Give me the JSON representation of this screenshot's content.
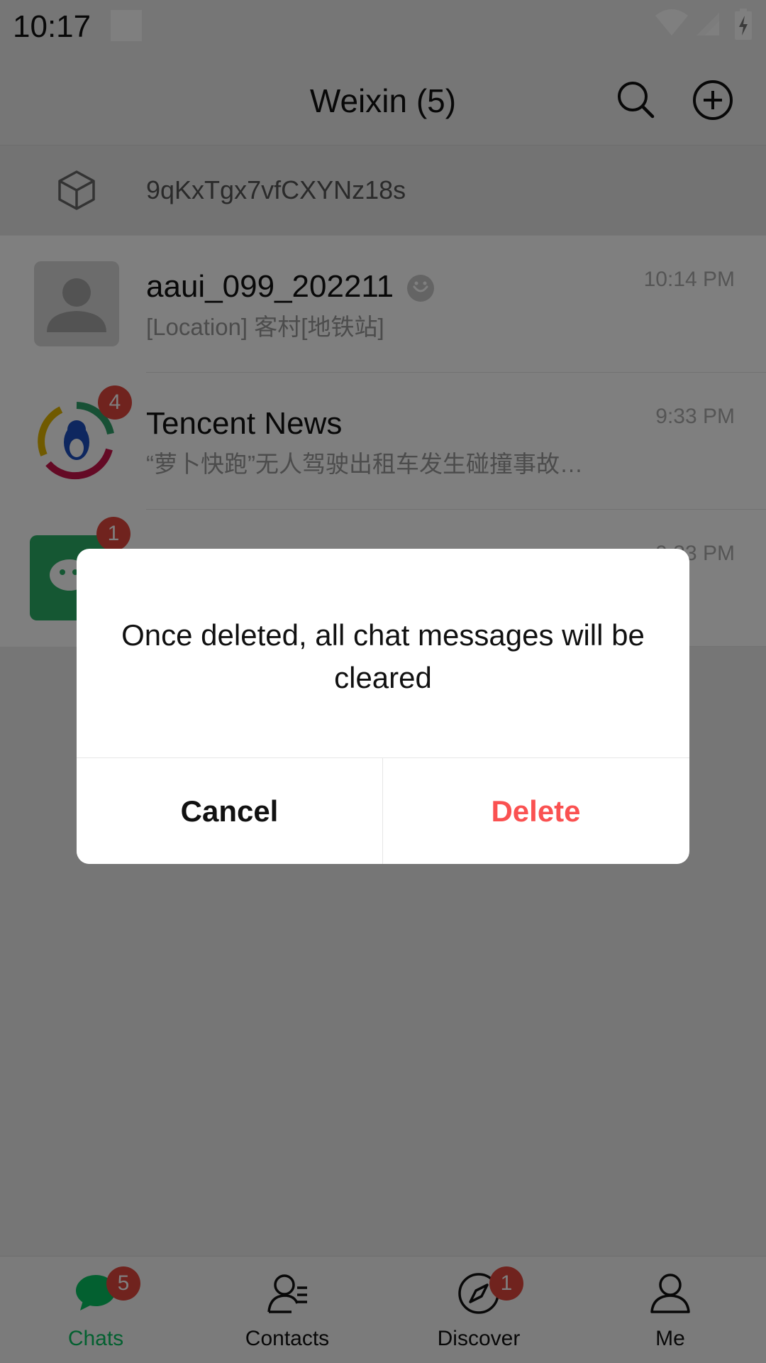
{
  "status_bar": {
    "time": "10:17"
  },
  "header": {
    "title": "Weixin (5)"
  },
  "device_bar": {
    "text": "9qKxTgx7vfCXYNz18s"
  },
  "chats": [
    {
      "name": "aaui_099_202211",
      "preview": "[Location]  客村[地铁站]",
      "time": "10:14 PM",
      "badge": ""
    },
    {
      "name": "Tencent News",
      "preview": "“萝卜快跑”无人驾驶出租车发生碰撞事故…",
      "time": "9:33 PM",
      "badge": "4"
    },
    {
      "name": "",
      "preview": "",
      "time": "9:33 PM",
      "badge": "1"
    }
  ],
  "dialog": {
    "message": "Once deleted, all chat messages will be cleared",
    "cancel_label": "Cancel",
    "delete_label": "Delete"
  },
  "tabs": [
    {
      "label": "Chats",
      "badge": "5",
      "active": true
    },
    {
      "label": "Contacts",
      "badge": "",
      "active": false
    },
    {
      "label": "Discover",
      "badge": "1",
      "active": false
    },
    {
      "label": "Me",
      "badge": "",
      "active": false
    }
  ],
  "colors": {
    "accent_green": "#07c160",
    "delete_red": "#fa5151",
    "badge_red": "#e0463c",
    "news_avatar_red": "#e0463c"
  }
}
